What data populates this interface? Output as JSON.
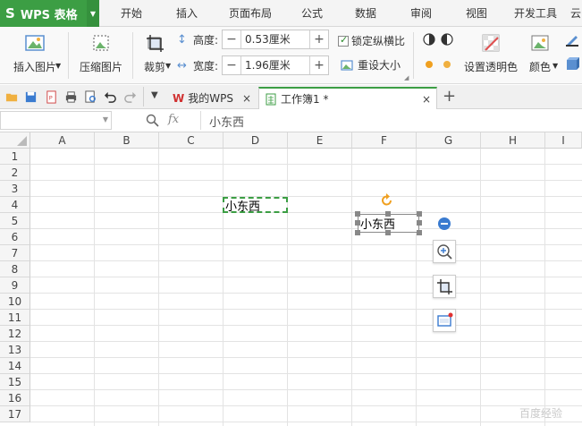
{
  "app": {
    "name": "WPS 表格",
    "logo": "S"
  },
  "menu": {
    "tabs": [
      "开始",
      "插入",
      "页面布局",
      "公式",
      "数据",
      "审阅",
      "视图",
      "开发工具",
      "云"
    ]
  },
  "ribbon": {
    "insert_picture": "插入图片",
    "compress_picture": "压缩图片",
    "crop": "裁剪",
    "height_label": "高度:",
    "height_value": "0.53厘米",
    "width_label": "宽度:",
    "width_value": "1.96厘米",
    "minus": "−",
    "plus": "+",
    "lock_ratio": "锁定纵横比",
    "reset_size": "重设大小",
    "set_transparent": "设置透明色",
    "color": "颜色"
  },
  "tabs_bar": {
    "home_tab": "我的WPS",
    "doc_tab": "工作簿1 *",
    "close": "×",
    "add": "+"
  },
  "formula_bar": {
    "fx": "fx",
    "content": "小东西"
  },
  "sheet": {
    "columns": [
      "A",
      "B",
      "C",
      "D",
      "E",
      "F",
      "G",
      "H",
      "I"
    ],
    "rows": [
      "1",
      "2",
      "3",
      "4",
      "5",
      "6",
      "7",
      "8",
      "9",
      "10",
      "11",
      "12",
      "13",
      "14",
      "15",
      "16",
      "17"
    ],
    "cell_d4": "小东西",
    "picture_text": "小东西"
  },
  "colors": {
    "accent": "#3c9e44",
    "copy_border": "#3c9e44",
    "rotate_handle": "#f0a020"
  },
  "watermark": "百度经验"
}
